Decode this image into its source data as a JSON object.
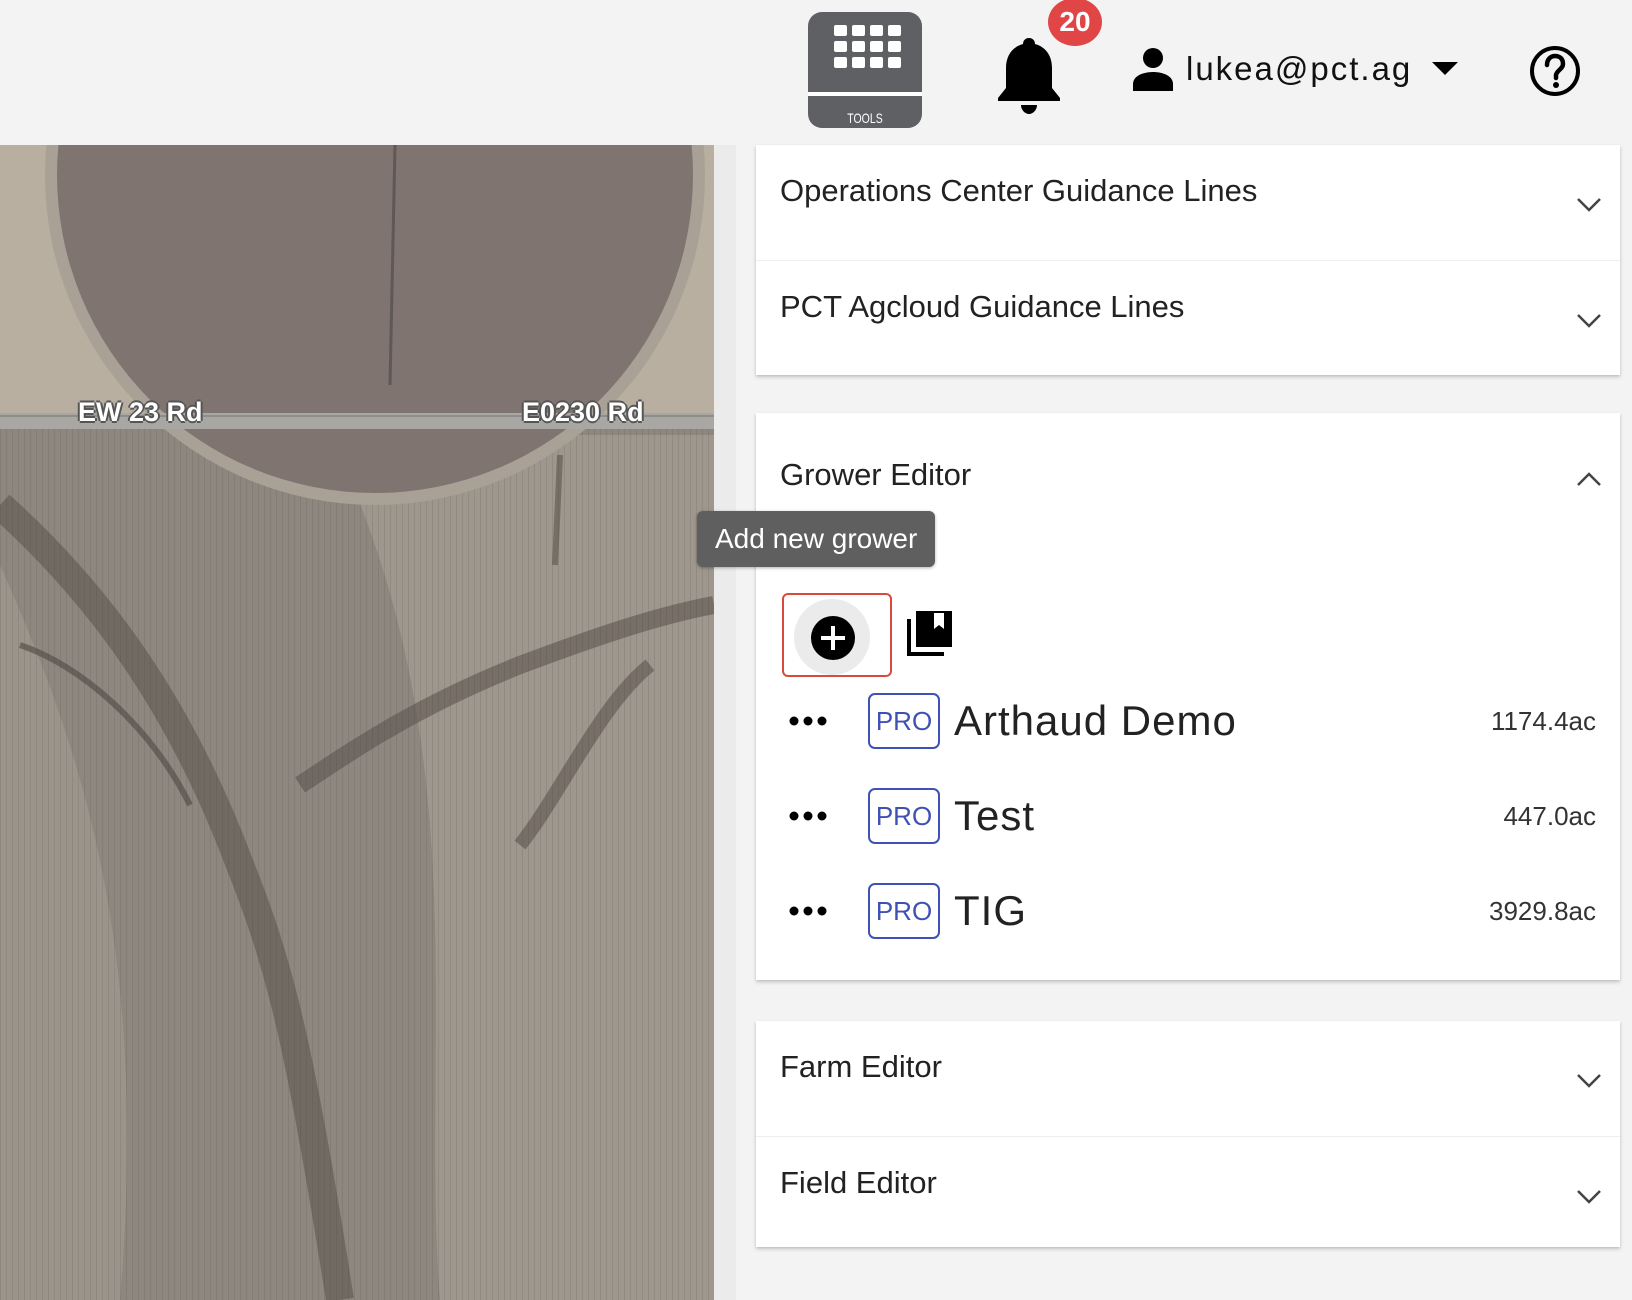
{
  "header": {
    "tools_label": "TOOLS",
    "notification_count": "20",
    "user_email": "lukea@pct.ag"
  },
  "map": {
    "road_labels": [
      "EW 23 Rd",
      "E0230 Rd"
    ]
  },
  "tooltip": "Add new grower",
  "accordions_top": [
    {
      "title": "Operations Center Guidance Lines"
    },
    {
      "title": "PCT Agcloud Guidance Lines"
    }
  ],
  "grower_editor": {
    "title": "Grower Editor",
    "badge": "PRO",
    "growers": [
      {
        "name": "Arthaud Demo",
        "acres": "1174.4ac"
      },
      {
        "name": "Test",
        "acres": "447.0ac"
      },
      {
        "name": "TIG",
        "acres": "3929.8ac"
      }
    ]
  },
  "accordions_bottom": [
    {
      "title": "Farm Editor"
    },
    {
      "title": "Field Editor"
    }
  ],
  "colors": {
    "badge_red": "#e04646",
    "pro_blue": "#3f51b5",
    "highlight_red": "#d94a3d",
    "tools_gray": "#5f6063"
  }
}
